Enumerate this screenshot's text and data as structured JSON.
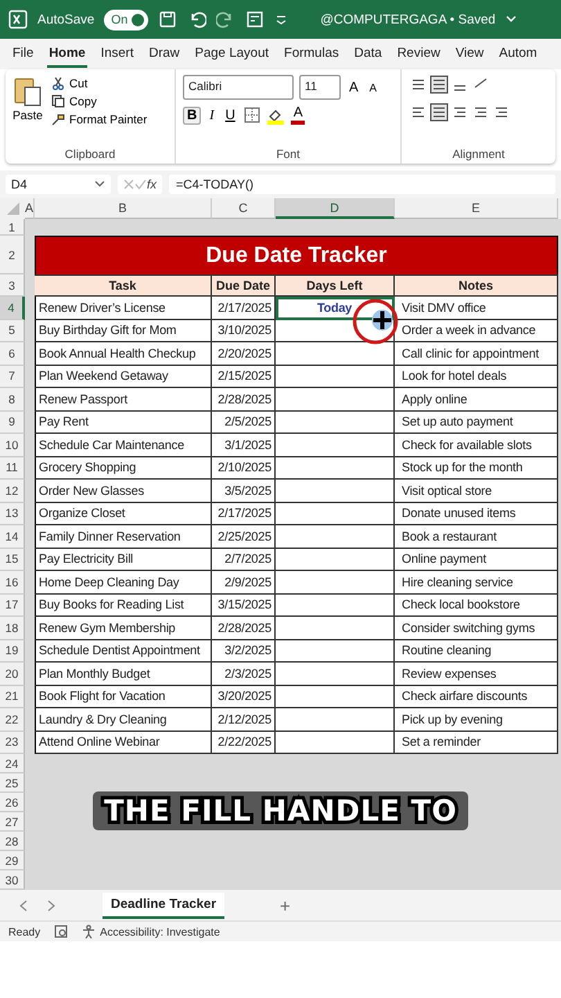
{
  "title_bar": {
    "autosave_label": "AutoSave",
    "autosave_on": true,
    "autosave_state": "On",
    "title": "@COMPUTERGAGA • Saved"
  },
  "ribbon_tabs": [
    {
      "label": "File",
      "selected": false
    },
    {
      "label": "Home",
      "selected": true
    },
    {
      "label": "Insert",
      "selected": false
    },
    {
      "label": "Draw",
      "selected": false
    },
    {
      "label": "Page Layout",
      "selected": false
    },
    {
      "label": "Formulas",
      "selected": false
    },
    {
      "label": "Data",
      "selected": false
    },
    {
      "label": "Review",
      "selected": false
    },
    {
      "label": "View",
      "selected": false
    },
    {
      "label": "Autom",
      "selected": false
    }
  ],
  "clipboard": {
    "paste": "Paste",
    "cut": "Cut",
    "copy": "Copy",
    "format_painter": "Format Painter",
    "group": "Clipboard"
  },
  "font": {
    "name": "Calibri",
    "size": "11",
    "grow": "A",
    "shrink": "A",
    "bold": "B",
    "italic": "I",
    "underline": "U",
    "font_color": "A",
    "group": "Font"
  },
  "alignment": {
    "group": "Alignment"
  },
  "formula_bar": {
    "name_box": "D4",
    "fx": "fx",
    "formula": "=C4-TODAY()"
  },
  "columns": [
    {
      "label": "A",
      "selected": false
    },
    {
      "label": "B",
      "selected": false
    },
    {
      "label": "C",
      "selected": false
    },
    {
      "label": "D",
      "selected": true
    },
    {
      "label": "E",
      "selected": false
    }
  ],
  "row_numbers": [
    {
      "label": "1",
      "selected": false
    },
    {
      "label": "2",
      "selected": false
    },
    {
      "label": "3",
      "selected": false
    },
    {
      "label": "4",
      "selected": true
    },
    {
      "label": "5",
      "selected": false
    },
    {
      "label": "6",
      "selected": false
    },
    {
      "label": "7",
      "selected": false
    },
    {
      "label": "8",
      "selected": false
    },
    {
      "label": "9",
      "selected": false
    },
    {
      "label": "10",
      "selected": false
    },
    {
      "label": "11",
      "selected": false
    },
    {
      "label": "12",
      "selected": false
    },
    {
      "label": "13",
      "selected": false
    },
    {
      "label": "14",
      "selected": false
    },
    {
      "label": "15",
      "selected": false
    },
    {
      "label": "16",
      "selected": false
    },
    {
      "label": "17",
      "selected": false
    },
    {
      "label": "18",
      "selected": false
    },
    {
      "label": "19",
      "selected": false
    },
    {
      "label": "20",
      "selected": false
    },
    {
      "label": "21",
      "selected": false
    },
    {
      "label": "22",
      "selected": false
    },
    {
      "label": "23",
      "selected": false
    },
    {
      "label": "24",
      "selected": false
    },
    {
      "label": "25",
      "selected": false
    },
    {
      "label": "26",
      "selected": false
    },
    {
      "label": "27",
      "selected": false
    },
    {
      "label": "28",
      "selected": false
    },
    {
      "label": "29",
      "selected": false
    },
    {
      "label": "30",
      "selected": false
    }
  ],
  "table": {
    "title": "Due Date Tracker",
    "headers": [
      "Task",
      "Due Date",
      "Days Left",
      "Notes"
    ],
    "rows": [
      {
        "task": "Renew Driver’s License",
        "due": "2/17/2025",
        "days_left": "Today",
        "notes": "Visit DMV office",
        "selected": true
      },
      {
        "task": "Buy Birthday Gift for Mom",
        "due": "3/10/2025",
        "notes": "Order a week in advance",
        "selected": false
      },
      {
        "task": "Book Annual Health Checkup",
        "due": "2/20/2025",
        "notes": "Call clinic for appointment",
        "selected": false
      },
      {
        "task": "Plan Weekend Getaway",
        "due": "2/15/2025",
        "notes": "Look for hotel deals",
        "selected": false
      },
      {
        "task": "Renew Passport",
        "due": "2/28/2025",
        "notes": "Apply online",
        "selected": false
      },
      {
        "task": "Pay Rent",
        "due": "2/5/2025",
        "notes": "Set up auto payment",
        "selected": false
      },
      {
        "task": "Schedule Car Maintenance",
        "due": "3/1/2025",
        "notes": "Check for available slots",
        "selected": false
      },
      {
        "task": "Grocery Shopping",
        "due": "2/10/2025",
        "notes": "Stock up for the month",
        "selected": false
      },
      {
        "task": "Order New Glasses",
        "due": "3/5/2025",
        "notes": "Visit optical store",
        "selected": false
      },
      {
        "task": "Organize Closet",
        "due": "2/17/2025",
        "notes": "Donate unused items",
        "selected": false
      },
      {
        "task": "Family Dinner Reservation",
        "due": "2/25/2025",
        "notes": "Book a restaurant",
        "selected": false
      },
      {
        "task": "Pay Electricity Bill",
        "due": "2/7/2025",
        "notes": "Online payment",
        "selected": false
      },
      {
        "task": "Home Deep Cleaning Day",
        "due": "2/9/2025",
        "notes": "Hire cleaning service",
        "selected": false
      },
      {
        "task": "Buy Books for Reading List",
        "due": "3/15/2025",
        "notes": "Check local bookstore",
        "selected": false
      },
      {
        "task": "Renew Gym Membership",
        "due": "2/28/2025",
        "notes": "Consider switching gyms",
        "selected": false
      },
      {
        "task": "Schedule Dentist Appointment",
        "due": "3/2/2025",
        "notes": "Routine cleaning",
        "selected": false
      },
      {
        "task": "Plan Monthly Budget",
        "due": "2/3/2025",
        "notes": "Review expenses",
        "selected": false
      },
      {
        "task": "Book Flight for Vacation",
        "due": "3/20/2025",
        "notes": "Check airfare discounts",
        "selected": false
      },
      {
        "task": "Laundry & Dry Cleaning",
        "due": "2/12/2025",
        "notes": "Pick up by evening",
        "selected": false
      },
      {
        "task": "Attend Online Webinar",
        "due": "2/22/2025",
        "notes": "Set a reminder",
        "selected": false
      }
    ]
  },
  "caption": "THE FILL HANDLE TO",
  "sheet_tabs": [
    {
      "label": "Deadline Tracker",
      "selected": true
    }
  ],
  "add_sheet": "+",
  "status_bar": {
    "ready": "Ready",
    "accessibility": "Accessibility: Investigate"
  }
}
